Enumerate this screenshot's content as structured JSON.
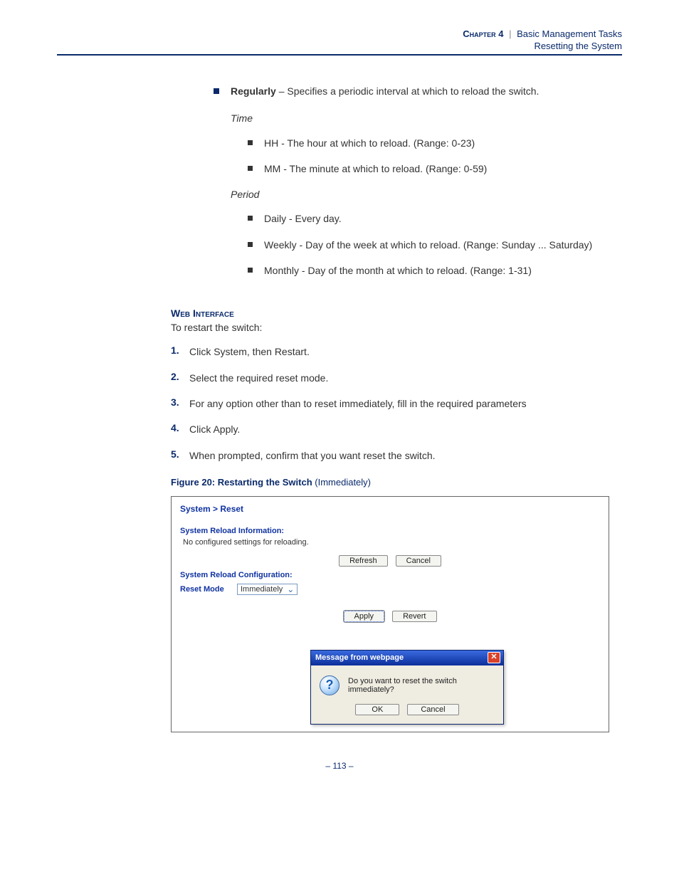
{
  "header": {
    "chapter_label": "Chapter 4",
    "chapter_title": "Basic Management Tasks",
    "section_title": "Resetting the System"
  },
  "bullets": {
    "regularly_bold": "Regularly",
    "regularly_text": " – Specifies a periodic interval at which to reload the switch.",
    "time_heading": "Time",
    "hh": "HH - The hour at which to reload. (Range: 0-23)",
    "mm": "MM - The minute at which to reload. (Range: 0-59)",
    "period_heading": "Period",
    "daily": "Daily - Every day.",
    "weekly": "Weekly - Day of the week at which to reload. (Range: Sunday ... Saturday)",
    "monthly": "Monthly - Day of the month at which to reload. (Range: 1-31)"
  },
  "web_interface": {
    "heading": "Web Interface",
    "intro": "To restart the switch:",
    "steps": [
      "Click System, then Restart.",
      "Select the required reset mode.",
      "For any option other than to reset immediately, fill in the required parameters",
      "Click Apply.",
      " When prompted, confirm that you want reset the switch."
    ]
  },
  "figure": {
    "label": "Figure 20:  Restarting the Switch ",
    "suffix": "(Immediately)"
  },
  "screenshot": {
    "breadcrumb": "System > Reset",
    "info_heading": "System Reload Information:",
    "info_text": "No configured settings for reloading.",
    "refresh": "Refresh",
    "cancel": "Cancel",
    "config_heading": "System Reload Configuration:",
    "reset_mode_label": "Reset Mode",
    "reset_mode_value": "Immediately",
    "apply": "Apply",
    "revert": "Revert"
  },
  "dialog": {
    "title": "Message from webpage",
    "message": "Do you want to reset the switch immediately?",
    "ok": "OK",
    "cancel": "Cancel"
  },
  "page_number": "113"
}
